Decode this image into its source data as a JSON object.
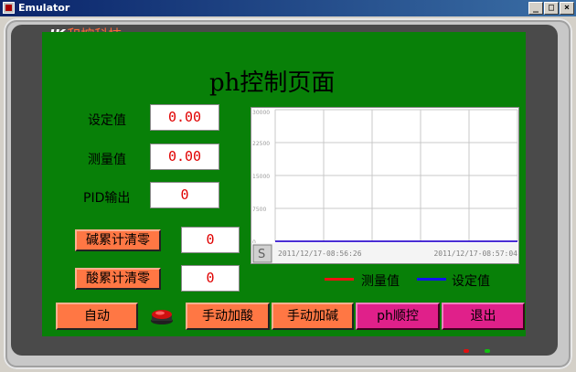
{
  "window": {
    "title": "Emulator",
    "buttons": {
      "minimize": "_",
      "maximize": "□",
      "close": "×"
    }
  },
  "logo": {
    "mark": "IK",
    "text": "和控科技"
  },
  "page": {
    "title": "ph控制页面"
  },
  "fields": {
    "setpoint": {
      "label": "设定值",
      "value": "0.00"
    },
    "measured": {
      "label": "测量值",
      "value": "0.00"
    },
    "pid_output": {
      "label": "PID输出",
      "value": "0"
    },
    "alkali_total": {
      "button": "碱累计清零",
      "value": "0"
    },
    "acid_total": {
      "button": "酸累计清零",
      "value": "0"
    }
  },
  "chart_data": {
    "type": "line",
    "y_ticks": [
      "30000",
      "22500",
      "15000",
      "7500",
      "0"
    ],
    "ylim": [
      0,
      30000
    ],
    "x_start": "2011/12/17-08:56:26",
    "x_end": "2011/12/17-08:57:04",
    "grid": true,
    "series": [
      {
        "name": "测量值",
        "color": "#ee1111",
        "values": [
          0,
          0
        ]
      },
      {
        "name": "设定值",
        "color": "#1111ee",
        "values": [
          0,
          0
        ]
      }
    ],
    "scroll_button": "S"
  },
  "buttons": {
    "auto": "自动",
    "manual_acid": "手动加酸",
    "manual_alkali": "手动加碱",
    "ph_sequence": "ph顺控",
    "exit": "退出"
  },
  "colors": {
    "screen_bg": "#088008",
    "orange_button": "#ff7744",
    "magenta_button": "#e0208a",
    "value_text": "#e00000"
  }
}
